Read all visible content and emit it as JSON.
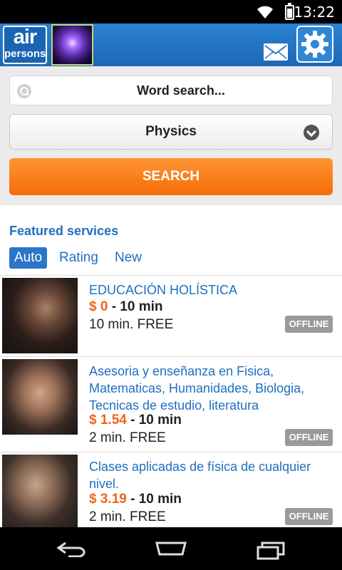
{
  "status_bar": {
    "time": "13:22"
  },
  "app": {
    "logo_top": "air",
    "logo_bottom": "persons",
    "icons": [
      "mail-icon",
      "gear-icon"
    ]
  },
  "search": {
    "placeholder": "Word search...",
    "category": "Physics",
    "button_label": "SEARCH"
  },
  "featured": {
    "title": "Featured services",
    "tabs": [
      {
        "label": "Auto",
        "active": true
      },
      {
        "label": "Rating",
        "active": false
      },
      {
        "label": "New",
        "active": false
      }
    ],
    "items": [
      {
        "title": "EDUCACIÓN HOLÍSTICA",
        "price": "$ 0",
        "duration": "- 10 min",
        "free": "10 min. FREE",
        "status": "OFFLINE"
      },
      {
        "title": "Asesoria y enseñanza en Fisica, Matematicas, Humanidades, Biologia, Tecnicas de estudio, literatura",
        "price": "$ 1.54",
        "duration": "- 10 min",
        "free": "2 min. FREE",
        "status": "OFFLINE"
      },
      {
        "title": "Clases aplicadas de física de cualquier nivel.",
        "price": "$ 3.19",
        "duration": "- 10 min",
        "free": "2 min. FREE",
        "status": "OFFLINE"
      }
    ]
  },
  "colors": {
    "accent_blue": "#1e6fc0",
    "orange": "#f46c08",
    "price_orange": "#f06419",
    "badge_gray": "#9a9a9a"
  }
}
